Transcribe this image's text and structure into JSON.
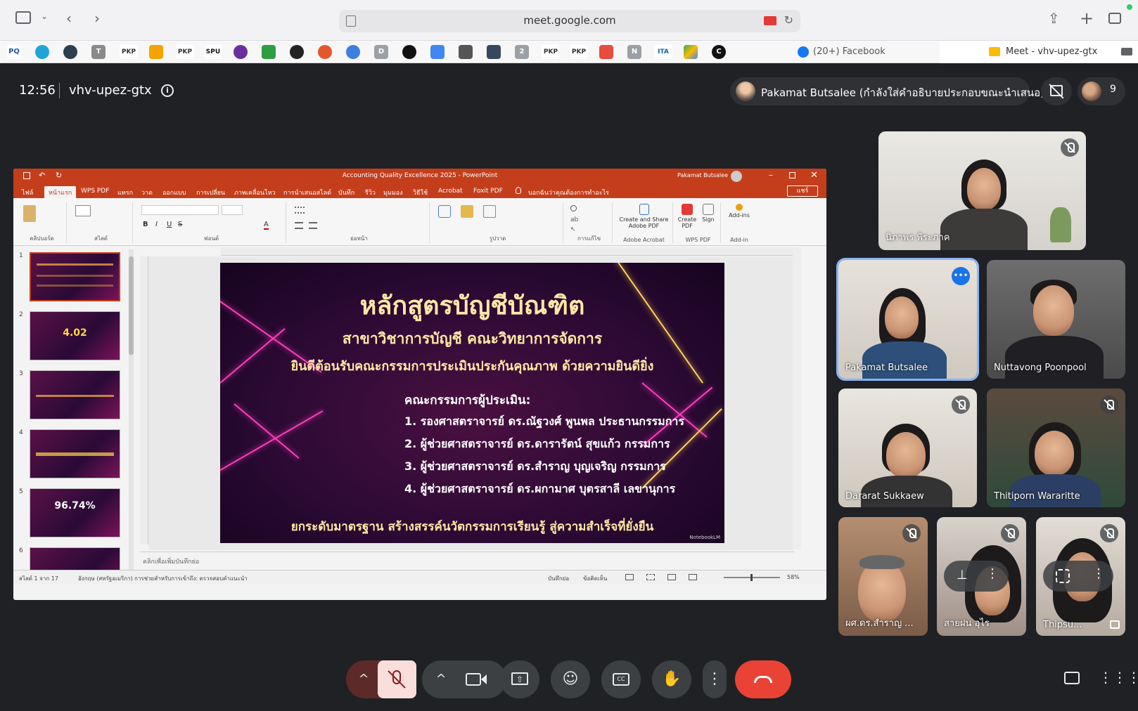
{
  "browser": {
    "url": "meet.google.com",
    "bookmarks": [
      "PQ",
      "PKP",
      "PKP",
      "SPU",
      "PKP",
      "PKP",
      "PKP",
      "D",
      "2",
      "N",
      "ITA"
    ],
    "tab_facebook": "(20+) Facebook",
    "tab_meet": "Meet - vhv-upez-gtx"
  },
  "meet": {
    "time": "12:56",
    "code": "vhv-upez-gtx",
    "presenter_banner": "Pakamat Butsalee (กำลังใส่คำอธิบายประกอบขณะนำเสนอ)",
    "participant_count": "9"
  },
  "powerpoint": {
    "title": "Accounting Quality Excellence 2025 - PowerPoint",
    "user": "Pakamat Butsalee",
    "menu": [
      "ไฟล์",
      "หน้าแรก",
      "WPS PDF",
      "แทรก",
      "วาด",
      "ออกแบบ",
      "การเปลี่ยน",
      "ภาพเคลื่อนไหว",
      "การนำเสนอสไลด์",
      "บันทึก",
      "รีวิว",
      "มุมมอง",
      "วิธีใช้",
      "Acrobat",
      "Foxit PDF",
      "บอกฉันว่าคุณต้องการทำอะไร"
    ],
    "share_label": "แชร์",
    "ribbon_groups": [
      "คลิปบอร์ด",
      "สไลด์",
      "ฟอนต์",
      "ย่อหน้า",
      "รูปวาด",
      "การแก้ไข",
      "Adobe Acrobat",
      "WPS PDF",
      "Add-in"
    ],
    "ribbon_buttons": {
      "create_share": "Create and Share Adobe PDF",
      "create_pdf": "Create PDF",
      "sign": "Sign",
      "addins": "Add-ins"
    },
    "thumb_numbers": [
      "1",
      "2",
      "3",
      "4",
      "5",
      "6"
    ],
    "thumb_values": [
      "",
      "4.02",
      "",
      "",
      "96.74%",
      ""
    ],
    "notes_placeholder": "คลิกเพื่อเพิ่มบันทึกย่อ",
    "status": {
      "slide": "สไลด์ 1 จาก 17",
      "language": "อังกฤษ (สหรัฐอเมริกา)",
      "accessibility": "การช่วยสำหรับการเข้าถึง: ตรวจสอบคำแนะนำ",
      "notes": "บันทึกย่อ",
      "comments": "ข้อคิดเห็น",
      "zoom": "58%"
    }
  },
  "slide": {
    "title": "หลักสูตรบัญชีบัณฑิต",
    "subtitle": "สาขาวิชาการบัญชี คณะวิทยาการจัดการ",
    "welcome": "ยินดีต้อนรับคณะกรรมการประเมินประกันคุณภาพ ด้วยความยินดียิ่ง",
    "committee_title": "คณะกรรมการผู้ประเมิน:",
    "members": [
      "1. รองศาสตราจารย์ ดร.ณัฐวงศ์ พูนพล    ประธานกรรมการ",
      "2. ผู้ช่วยศาสตราจารย์ ดร.ดารารัตน์ สุขแก้ว กรรมการ",
      "3. ผู้ช่วยศาสตราจารย์ ดร.สำราญ บุญเจริญ กรรมการ",
      "4. ผู้ช่วยศาสตราจารย์ ดร.ผกามาศ บุตรสาลี เลขานุการ"
    ],
    "slogan": "ยกระดับมาตรฐาน สร้างสรรค์นวัตกรรมการเรียนรู้ สู่ความสำเร็จที่ยั่งยืน",
    "brand": "NotebookLM"
  },
  "participants": [
    {
      "name": "นิภาพร พิระภาค"
    },
    {
      "name": "Pakamat Butsalee"
    },
    {
      "name": "Nuttavong Poonpool"
    },
    {
      "name": "Dararat Sukkaew"
    },
    {
      "name": "Thitiporn Wararitte"
    },
    {
      "name": "ผศ.ดร.สำราญ ..."
    },
    {
      "name": "สายฝน อุไร"
    },
    {
      "name": "Thipsu..."
    }
  ],
  "colors": {
    "meet_bg": "#202124",
    "ppt_accent": "#c43e1c",
    "end_call": "#ea4335",
    "mic_off": "#f9dedc",
    "speaking": "#1a73e8"
  },
  "icons": [
    "sidebar-icon",
    "back-icon",
    "forward-icon",
    "share-icon",
    "new-tab-icon",
    "tabs-icon",
    "info-icon",
    "mic-off-icon",
    "camera-icon",
    "present-icon",
    "emoji-icon",
    "captions-icon",
    "raise-hand-icon",
    "more-icon",
    "end-call-icon",
    "chat-icon",
    "apps-icon"
  ]
}
